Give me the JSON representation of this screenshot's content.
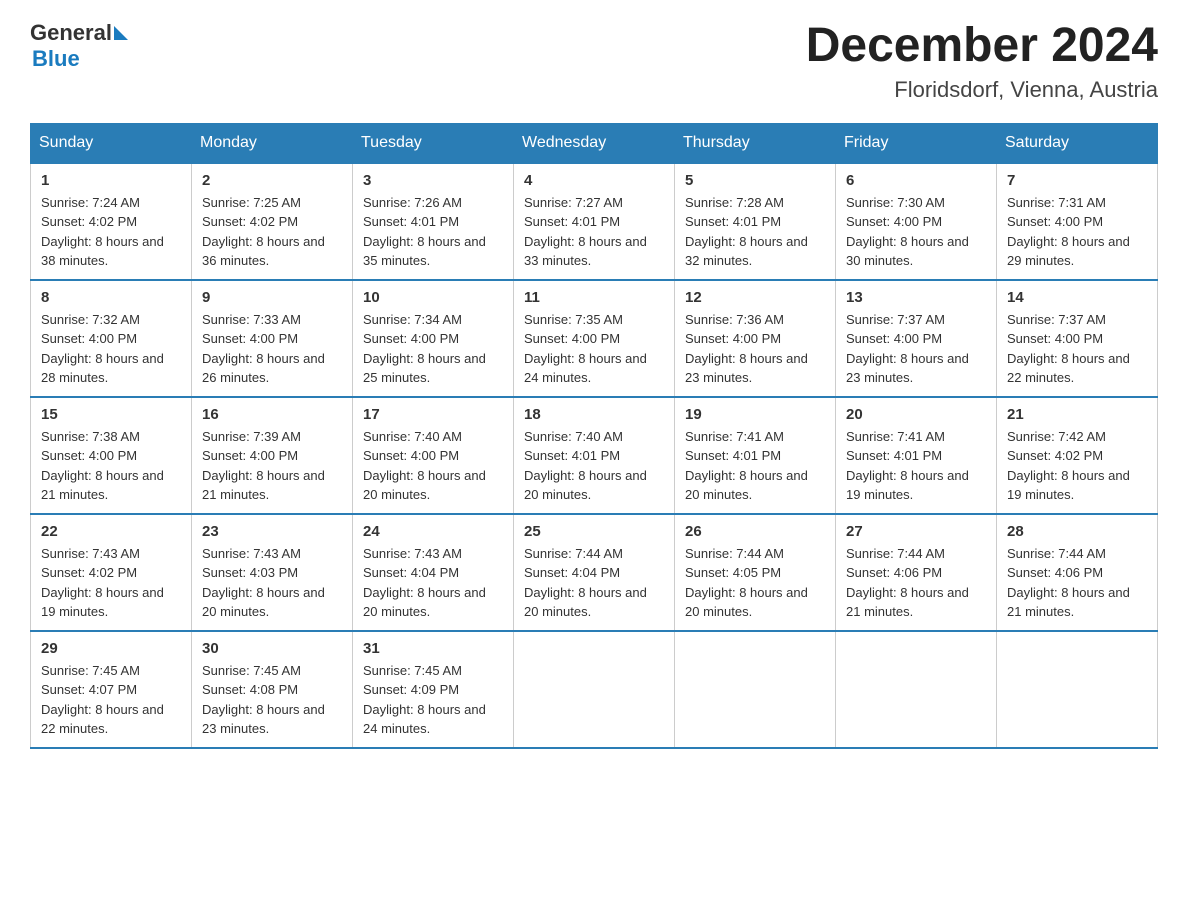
{
  "header": {
    "logo_text": "General",
    "logo_blue": "Blue",
    "month_title": "December 2024",
    "location": "Floridsdorf, Vienna, Austria"
  },
  "days_of_week": [
    "Sunday",
    "Monday",
    "Tuesday",
    "Wednesday",
    "Thursday",
    "Friday",
    "Saturday"
  ],
  "weeks": [
    [
      {
        "day": "1",
        "sunrise": "7:24 AM",
        "sunset": "4:02 PM",
        "daylight": "8 hours and 38 minutes."
      },
      {
        "day": "2",
        "sunrise": "7:25 AM",
        "sunset": "4:02 PM",
        "daylight": "8 hours and 36 minutes."
      },
      {
        "day": "3",
        "sunrise": "7:26 AM",
        "sunset": "4:01 PM",
        "daylight": "8 hours and 35 minutes."
      },
      {
        "day": "4",
        "sunrise": "7:27 AM",
        "sunset": "4:01 PM",
        "daylight": "8 hours and 33 minutes."
      },
      {
        "day": "5",
        "sunrise": "7:28 AM",
        "sunset": "4:01 PM",
        "daylight": "8 hours and 32 minutes."
      },
      {
        "day": "6",
        "sunrise": "7:30 AM",
        "sunset": "4:00 PM",
        "daylight": "8 hours and 30 minutes."
      },
      {
        "day": "7",
        "sunrise": "7:31 AM",
        "sunset": "4:00 PM",
        "daylight": "8 hours and 29 minutes."
      }
    ],
    [
      {
        "day": "8",
        "sunrise": "7:32 AM",
        "sunset": "4:00 PM",
        "daylight": "8 hours and 28 minutes."
      },
      {
        "day": "9",
        "sunrise": "7:33 AM",
        "sunset": "4:00 PM",
        "daylight": "8 hours and 26 minutes."
      },
      {
        "day": "10",
        "sunrise": "7:34 AM",
        "sunset": "4:00 PM",
        "daylight": "8 hours and 25 minutes."
      },
      {
        "day": "11",
        "sunrise": "7:35 AM",
        "sunset": "4:00 PM",
        "daylight": "8 hours and 24 minutes."
      },
      {
        "day": "12",
        "sunrise": "7:36 AM",
        "sunset": "4:00 PM",
        "daylight": "8 hours and 23 minutes."
      },
      {
        "day": "13",
        "sunrise": "7:37 AM",
        "sunset": "4:00 PM",
        "daylight": "8 hours and 23 minutes."
      },
      {
        "day": "14",
        "sunrise": "7:37 AM",
        "sunset": "4:00 PM",
        "daylight": "8 hours and 22 minutes."
      }
    ],
    [
      {
        "day": "15",
        "sunrise": "7:38 AM",
        "sunset": "4:00 PM",
        "daylight": "8 hours and 21 minutes."
      },
      {
        "day": "16",
        "sunrise": "7:39 AM",
        "sunset": "4:00 PM",
        "daylight": "8 hours and 21 minutes."
      },
      {
        "day": "17",
        "sunrise": "7:40 AM",
        "sunset": "4:00 PM",
        "daylight": "8 hours and 20 minutes."
      },
      {
        "day": "18",
        "sunrise": "7:40 AM",
        "sunset": "4:01 PM",
        "daylight": "8 hours and 20 minutes."
      },
      {
        "day": "19",
        "sunrise": "7:41 AM",
        "sunset": "4:01 PM",
        "daylight": "8 hours and 20 minutes."
      },
      {
        "day": "20",
        "sunrise": "7:41 AM",
        "sunset": "4:01 PM",
        "daylight": "8 hours and 19 minutes."
      },
      {
        "day": "21",
        "sunrise": "7:42 AM",
        "sunset": "4:02 PM",
        "daylight": "8 hours and 19 minutes."
      }
    ],
    [
      {
        "day": "22",
        "sunrise": "7:43 AM",
        "sunset": "4:02 PM",
        "daylight": "8 hours and 19 minutes."
      },
      {
        "day": "23",
        "sunrise": "7:43 AM",
        "sunset": "4:03 PM",
        "daylight": "8 hours and 20 minutes."
      },
      {
        "day": "24",
        "sunrise": "7:43 AM",
        "sunset": "4:04 PM",
        "daylight": "8 hours and 20 minutes."
      },
      {
        "day": "25",
        "sunrise": "7:44 AM",
        "sunset": "4:04 PM",
        "daylight": "8 hours and 20 minutes."
      },
      {
        "day": "26",
        "sunrise": "7:44 AM",
        "sunset": "4:05 PM",
        "daylight": "8 hours and 20 minutes."
      },
      {
        "day": "27",
        "sunrise": "7:44 AM",
        "sunset": "4:06 PM",
        "daylight": "8 hours and 21 minutes."
      },
      {
        "day": "28",
        "sunrise": "7:44 AM",
        "sunset": "4:06 PM",
        "daylight": "8 hours and 21 minutes."
      }
    ],
    [
      {
        "day": "29",
        "sunrise": "7:45 AM",
        "sunset": "4:07 PM",
        "daylight": "8 hours and 22 minutes."
      },
      {
        "day": "30",
        "sunrise": "7:45 AM",
        "sunset": "4:08 PM",
        "daylight": "8 hours and 23 minutes."
      },
      {
        "day": "31",
        "sunrise": "7:45 AM",
        "sunset": "4:09 PM",
        "daylight": "8 hours and 24 minutes."
      },
      null,
      null,
      null,
      null
    ]
  ]
}
